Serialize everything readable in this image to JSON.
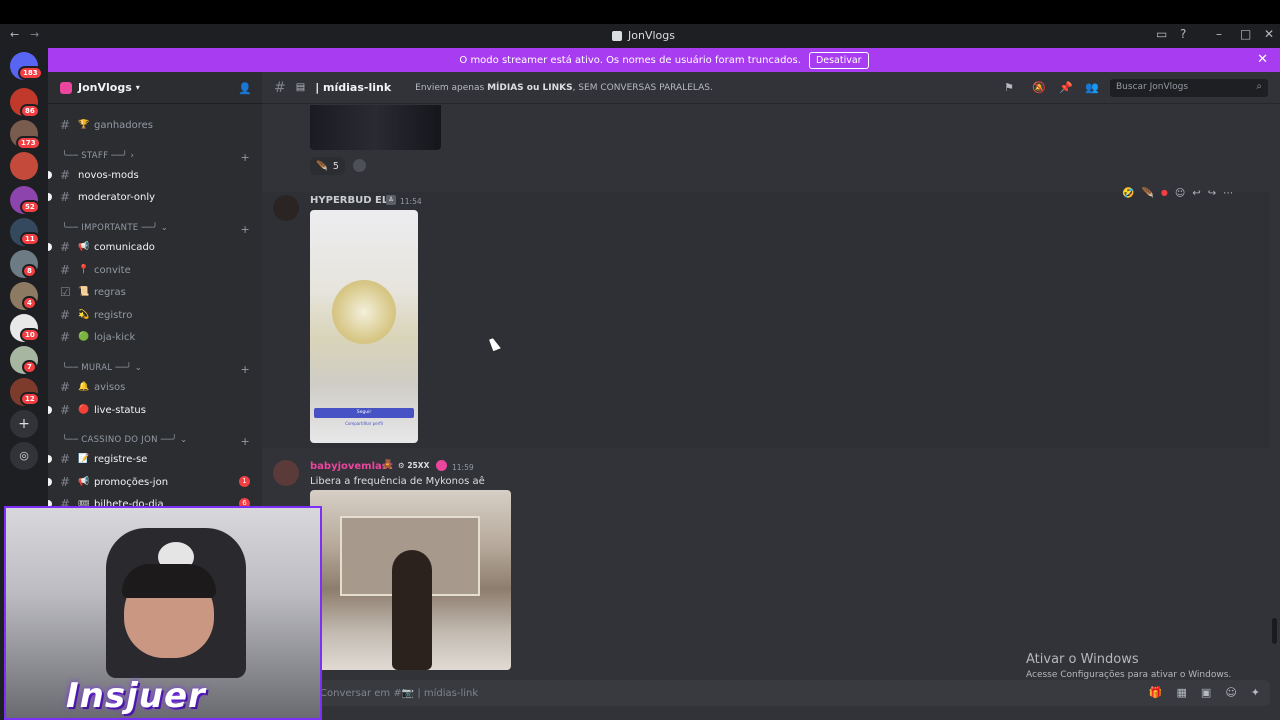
{
  "window": {
    "title": "JonVlogs"
  },
  "banner": {
    "message": "O modo streamer está ativo. Os nomes de usuário foram truncados.",
    "button_label": "Desativar",
    "color": "#a73cf0"
  },
  "rail": {
    "badges": [
      "183",
      "86",
      "173",
      "52",
      "11",
      "8",
      "4",
      "10",
      "7",
      "12"
    ]
  },
  "sidebar": {
    "guild_name": "JonVlogs",
    "channels_top": [
      {
        "name": "ganhadores",
        "emoji": "🏆"
      }
    ],
    "categories": [
      {
        "label": "STAFF"
      },
      {
        "label": "IMPORTANTE"
      },
      {
        "label": "MURAL"
      },
      {
        "label": "CASSINO DO JON"
      }
    ],
    "staff_channels": [
      {
        "name": "novos-mods"
      },
      {
        "name": "moderator-only"
      }
    ],
    "importante_channels": [
      {
        "name": "comunicado",
        "emoji": "📢"
      },
      {
        "name": "convite",
        "emoji": "📍"
      },
      {
        "name": "regras",
        "emoji": "📜"
      },
      {
        "name": "registro",
        "emoji": "💫"
      },
      {
        "name": "loja-kick",
        "emoji": "🟢"
      }
    ],
    "mural_channels": [
      {
        "name": "avisos",
        "emoji": "🔔"
      },
      {
        "name": "live-status",
        "emoji": "🔴"
      }
    ],
    "cassino_channels": [
      {
        "name": "registre-se",
        "emoji": "📝"
      },
      {
        "name": "promoções-jon",
        "emoji": "📢",
        "count": "1"
      },
      {
        "name": "bilhete-do-dia",
        "emoji": "🎟",
        "count": "6"
      }
    ]
  },
  "webcam": {
    "brand_text": "Insjuer"
  },
  "channel": {
    "name": "mídias-link",
    "topic_prefix": "Enviem apenas ",
    "topic_bold": "MÍDIAS ou LINKS",
    "topic_suffix": ", SEM CONVERSAS PARALELAS.",
    "search_placeholder": "Buscar JonVlogs"
  },
  "messages": {
    "prev_reaction_count": "5",
    "msg1": {
      "author": "HYPERBUD ELI",
      "time": "11:54",
      "image_button": "Seguir",
      "image_link": "Compartilhar perfil",
      "name_color": "#c9cdd1"
    },
    "msg2": {
      "author": "babyjovemlast",
      "badge": "25XX",
      "time": "11:59",
      "text": "Libera a frequência de Mykonos aê",
      "name_color": "#eb459e"
    }
  },
  "composer": {
    "placeholder": "Conversar em #📷 | mídias-link"
  },
  "watermark": {
    "title": "Ativar o Windows",
    "subtitle": "Acesse Configurações para ativar o Windows."
  }
}
